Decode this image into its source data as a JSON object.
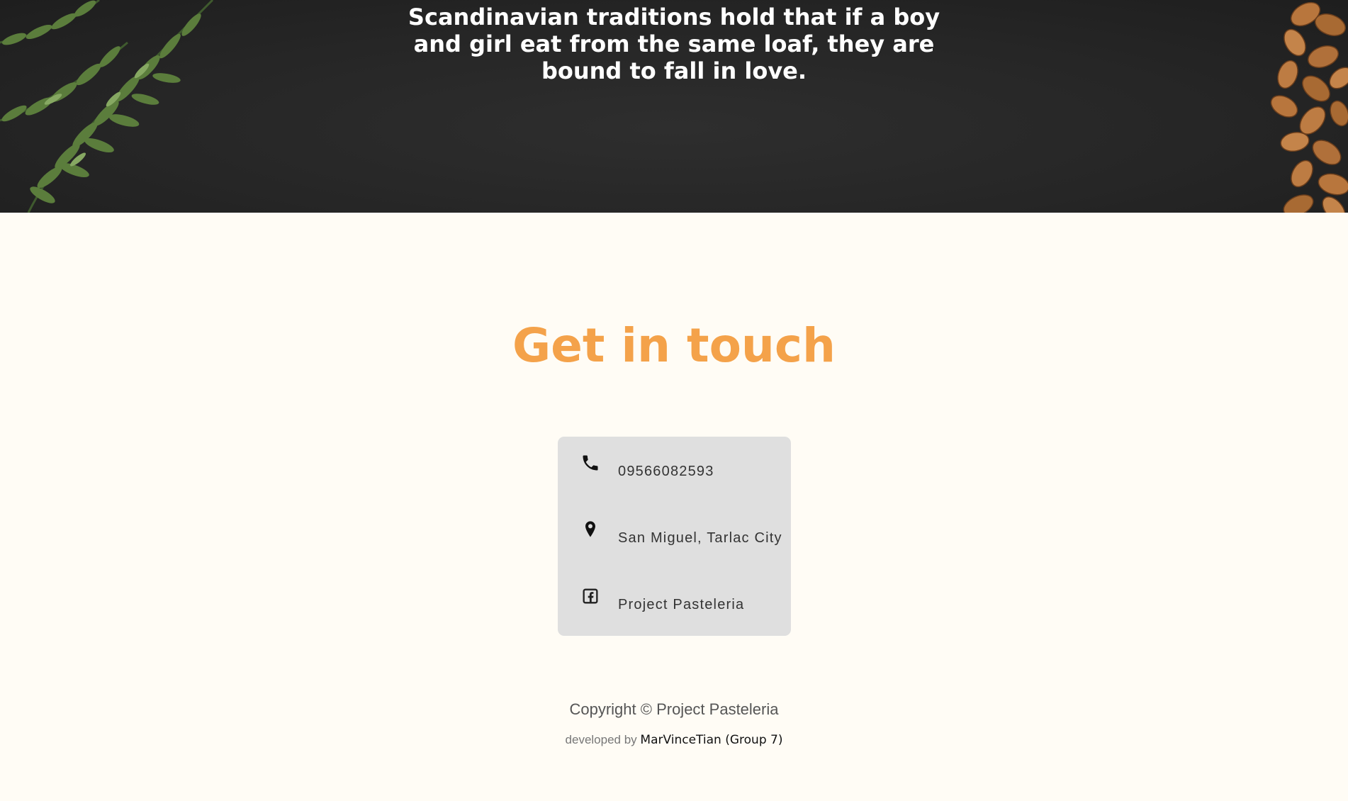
{
  "hero": {
    "quote": "Scandinavian traditions hold that if a boy and girl eat from the same loaf, they are bound to fall in love."
  },
  "contact": {
    "title": "Get in touch",
    "title_color": "#f4a24a",
    "items": [
      {
        "icon": "phone-icon",
        "text": "09566082593"
      },
      {
        "icon": "map-pin-icon",
        "text": "San Miguel, Tarlac City"
      },
      {
        "icon": "facebook-icon",
        "text": "Project Pasteleria"
      }
    ]
  },
  "footer": {
    "copyright": "Copyright © Project Pasteleria",
    "developed_prefix": "developed by",
    "developer": "MarVinceTian (Group 7)"
  }
}
